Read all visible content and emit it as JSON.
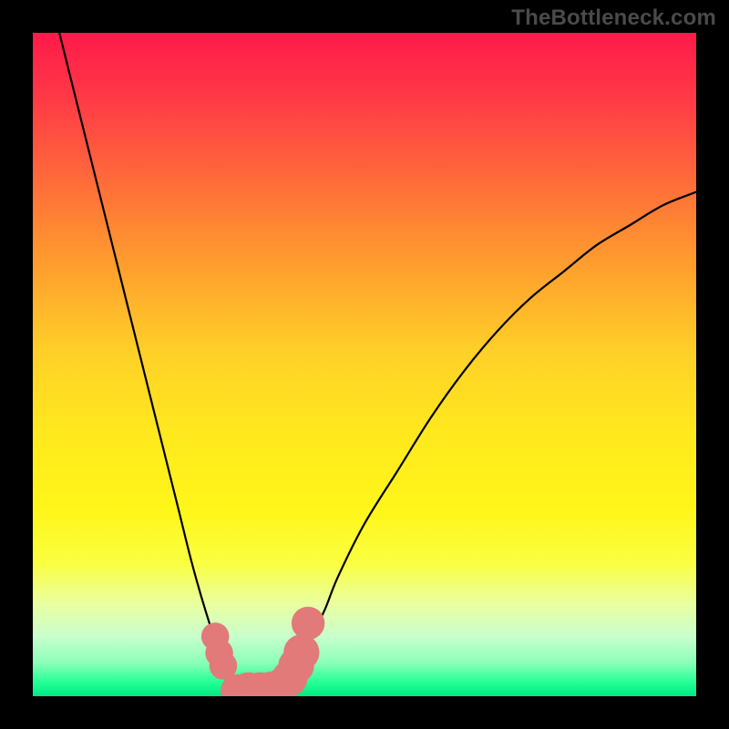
{
  "watermark": "TheBottleneck.com",
  "chart_data": {
    "type": "line",
    "title": "",
    "xlabel": "",
    "ylabel": "",
    "xlim": [
      0,
      100
    ],
    "ylim": [
      0,
      100
    ],
    "grid": false,
    "series": [
      {
        "name": "left-curve",
        "color": "#000000",
        "x": [
          4,
          6,
          8,
          10,
          12,
          14,
          16,
          18,
          20,
          22,
          24,
          26,
          28,
          30,
          31,
          32
        ],
        "values": [
          100,
          92,
          84,
          76,
          68,
          60,
          52,
          44,
          36,
          28,
          20,
          13,
          7,
          3,
          1,
          0
        ]
      },
      {
        "name": "right-curve",
        "color": "#000000",
        "x": [
          36,
          38,
          40,
          42,
          44,
          46,
          50,
          55,
          60,
          65,
          70,
          75,
          80,
          85,
          90,
          95,
          100
        ],
        "values": [
          0,
          2,
          5,
          9,
          13,
          18,
          26,
          34,
          42,
          49,
          55,
          60,
          64,
          68,
          71,
          74,
          76
        ]
      }
    ],
    "markers": {
      "name": "bottom-dots",
      "color": "#e17a78",
      "points": [
        {
          "x": 27.5,
          "y": 9.0,
          "r": 2.1
        },
        {
          "x": 28.1,
          "y": 6.5,
          "r": 2.1
        },
        {
          "x": 28.7,
          "y": 4.6,
          "r": 2.1
        },
        {
          "x": 30.8,
          "y": 0.8,
          "r": 2.5
        },
        {
          "x": 32.5,
          "y": 0.9,
          "r": 2.7
        },
        {
          "x": 34.2,
          "y": 0.9,
          "r": 2.7
        },
        {
          "x": 35.8,
          "y": 1.0,
          "r": 2.7
        },
        {
          "x": 37.3,
          "y": 1.4,
          "r": 2.7
        },
        {
          "x": 38.7,
          "y": 2.7,
          "r": 2.7
        },
        {
          "x": 39.7,
          "y": 4.6,
          "r": 2.7
        },
        {
          "x": 40.5,
          "y": 6.6,
          "r": 2.7
        },
        {
          "x": 41.5,
          "y": 11.0,
          "r": 2.5
        }
      ]
    },
    "gradient_stops": [
      {
        "pos": 0.0,
        "color": "#ff1a4a"
      },
      {
        "pos": 0.1,
        "color": "#ff3a46"
      },
      {
        "pos": 0.22,
        "color": "#ff6a3a"
      },
      {
        "pos": 0.34,
        "color": "#ff9a2e"
      },
      {
        "pos": 0.48,
        "color": "#ffd028"
      },
      {
        "pos": 0.6,
        "color": "#ffe81e"
      },
      {
        "pos": 0.72,
        "color": "#fff61a"
      },
      {
        "pos": 0.8,
        "color": "#faff42"
      },
      {
        "pos": 0.86,
        "color": "#eaffa0"
      },
      {
        "pos": 0.91,
        "color": "#c8ffcc"
      },
      {
        "pos": 0.95,
        "color": "#8affb8"
      },
      {
        "pos": 0.98,
        "color": "#22ff94"
      },
      {
        "pos": 1.0,
        "color": "#00e884"
      }
    ]
  }
}
